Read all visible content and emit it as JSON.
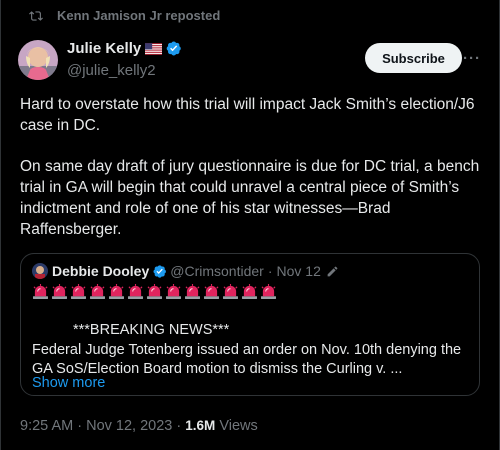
{
  "repost": {
    "label": "Kenn Jamison Jr reposted",
    "icon": "repost-icon"
  },
  "author": {
    "name": "Julie Kelly",
    "flag": "🇺🇸",
    "handle": "@julie_kelly2",
    "verified": true
  },
  "actions": {
    "subscribe_label": "Subscribe",
    "more_label": "···"
  },
  "body": {
    "paragraph1": "Hard to overstate how this trial will impact Jack Smith’s election/J6 case in DC.",
    "paragraph2": "On same day draft of jury questionnaire is due for DC trial, a bench trial in GA will begin that could unravel a central piece of Smith’s indictment and role of one of his star witnesses—Brad Raffensberger."
  },
  "quote": {
    "name": "Debbie Dooley",
    "handle": "@Crimsontider",
    "separator": "·",
    "date": "Nov 12",
    "siren_count": 13,
    "line1": "***BREAKING NEWS***",
    "line2": "Federal Judge Totenberg issued an order on Nov. 10th denying the",
    "line3": "GA SoS/Election Board motion to dismiss the Curling v. ...",
    "show_more": "Show more"
  },
  "meta": {
    "time": "9:25 AM",
    "separator": "·",
    "date": "Nov 12, 2023",
    "views": "1.6M",
    "views_label": "Views"
  },
  "colors": {
    "background": "#000000",
    "text": "#e7e9ea",
    "muted": "#71767b",
    "link": "#1d9bf0",
    "verified": "#1d9bf0",
    "siren": "#e0245e"
  }
}
